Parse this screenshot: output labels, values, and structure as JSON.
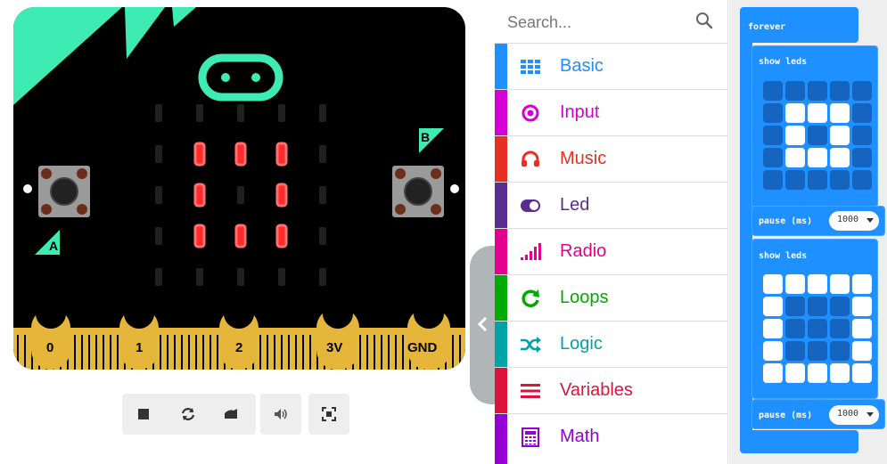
{
  "simulator": {
    "pins": [
      "0",
      "1",
      "2",
      "3V",
      "GND"
    ],
    "button_a_label": "A",
    "button_b_label": "B",
    "led_matrix": [
      [
        0,
        0,
        0,
        0,
        0
      ],
      [
        0,
        1,
        1,
        1,
        0
      ],
      [
        0,
        1,
        0,
        1,
        0
      ],
      [
        0,
        1,
        1,
        1,
        0
      ],
      [
        0,
        0,
        0,
        0,
        0
      ]
    ],
    "controls": [
      "stop-icon",
      "restart-icon",
      "debug-icon",
      "mute-icon",
      "fullscreen-icon"
    ],
    "board_color": "#000000",
    "accent_color": "#3eebb3",
    "led_on_color": "#ff2b2b",
    "pin_color": "#e6b63a"
  },
  "toolbox": {
    "search_placeholder": "Search...",
    "categories": [
      {
        "label": "Basic",
        "color": "#1e90ff",
        "icon": "grid-icon"
      },
      {
        "label": "Input",
        "color": "#d400d4",
        "icon": "target-icon"
      },
      {
        "label": "Music",
        "color": "#e63022",
        "icon": "headphones-icon"
      },
      {
        "label": "Led",
        "color": "#5c2d91",
        "icon": "toggle-icon"
      },
      {
        "label": "Radio",
        "color": "#e3008c",
        "icon": "signal-icon"
      },
      {
        "label": "Loops",
        "color": "#00aa00",
        "icon": "loop-icon"
      },
      {
        "label": "Logic",
        "color": "#00a4a6",
        "icon": "shuffle-icon"
      },
      {
        "label": "Variables",
        "color": "#dc143c",
        "icon": "lines-icon"
      },
      {
        "label": "Math",
        "color": "#9400d3",
        "icon": "calculator-icon"
      }
    ]
  },
  "workspace": {
    "event_label": "forever",
    "block1_label": "show leds",
    "block1_leds": [
      [
        0,
        0,
        0,
        0,
        0
      ],
      [
        0,
        1,
        1,
        1,
        0
      ],
      [
        0,
        1,
        0,
        1,
        0
      ],
      [
        0,
        1,
        1,
        1,
        0
      ],
      [
        0,
        0,
        0,
        0,
        0
      ]
    ],
    "pause1_label": "pause (ms)",
    "pause1_value": "1000",
    "block2_label": "show leds",
    "block2_leds": [
      [
        1,
        1,
        1,
        1,
        1
      ],
      [
        1,
        0,
        0,
        0,
        1
      ],
      [
        1,
        0,
        0,
        0,
        1
      ],
      [
        1,
        0,
        0,
        0,
        1
      ],
      [
        1,
        1,
        1,
        1,
        1
      ]
    ],
    "pause2_label": "pause (ms)",
    "pause2_value": "1000",
    "block_color": "#1e90ff",
    "led_off_color": "#1565c0"
  }
}
